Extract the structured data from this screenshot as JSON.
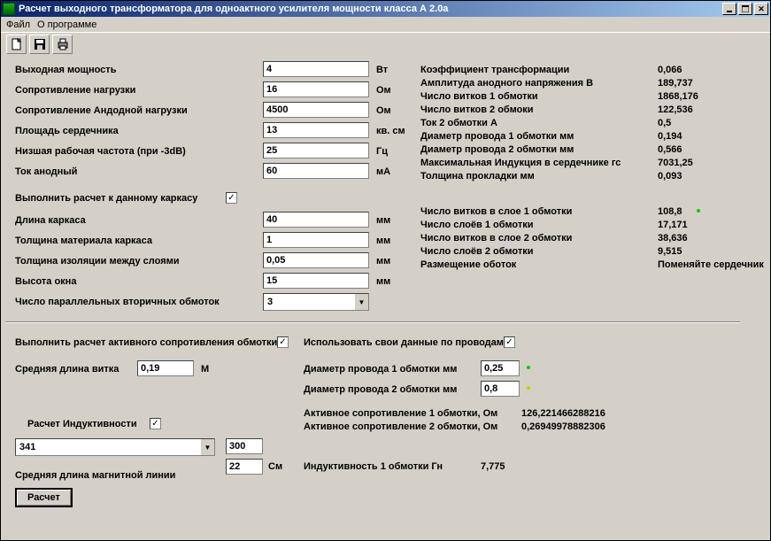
{
  "window": {
    "title": "Расчет выходного трансформатора для одноактного  усилителя мощности класса А  2.0a"
  },
  "menu": {
    "file": "Файл",
    "about": "О программе"
  },
  "colors": {
    "titlebar_start": "#0a246a",
    "titlebar_end": "#a6caf0",
    "bg": "#d4d0c8"
  },
  "inputs_left": {
    "out_power": {
      "label": "Выходная мощность",
      "value": "4",
      "unit": "Вт"
    },
    "load_res": {
      "label": "Сопротивление нагрузки",
      "value": "16",
      "unit": "Ом"
    },
    "anode_load_res": {
      "label": "Сопротивление Андодной нагрузки",
      "value": "4500",
      "unit": "Ом"
    },
    "core_area": {
      "label": "Площадь сердечника",
      "value": "13",
      "unit": "кв. см"
    },
    "low_freq": {
      "label": "Низшая рабочая частота (при -3dB)",
      "value": "25",
      "unit": "Гц"
    },
    "anode_current": {
      "label": "Ток анодный",
      "value": "60",
      "unit": "мА"
    },
    "calc_to_frame": {
      "label": "Выполнить расчет к данному каркасу",
      "checked": true
    },
    "frame_len": {
      "label": "Длина каркаса",
      "value": "40",
      "unit": "мм"
    },
    "frame_thickness": {
      "label": "Толщина материала каркаса",
      "value": "1",
      "unit": "мм"
    },
    "insul_thickness": {
      "label": "Толщина изоляции между слоями",
      "value": "0,05",
      "unit": "мм"
    },
    "window_height": {
      "label": "Высота окна",
      "value": "15",
      "unit": "мм"
    },
    "parallel_secondary": {
      "label": "Число параллельных вторичных обмоток",
      "value": "3"
    }
  },
  "results_right": {
    "trans_coef": {
      "label": "Коэффициент трансформации",
      "value": "0,066"
    },
    "anode_voltage": {
      "label": "Амплитуда анодного напряжения В",
      "value": "189,737"
    },
    "turns1": {
      "label": "Число витков 1 обмотки",
      "value": "1868,176"
    },
    "turns2": {
      "label": "Число витков 2 обмоки",
      "value": "122,536"
    },
    "current2": {
      "label": "Ток 2 обмотки А",
      "value": "0,5"
    },
    "wire1_dia": {
      "label": "Диаметр провода 1 обмотки мм",
      "value": "0,194"
    },
    "wire2_dia": {
      "label": "Диаметр провода 2 обмотки мм",
      "value": "0,566"
    },
    "max_induction": {
      "label": "Максимальная Индукция в сердечнике гс",
      "value": "7031,25"
    },
    "gasket_thickness": {
      "label": "Толщина прокладки мм",
      "value": "0,093"
    },
    "turns_layer1": {
      "label": "Число витков в слое 1 обмотки",
      "value": "108,8"
    },
    "layers1": {
      "label": "Число слоёв 1 обмотки",
      "value": "17,171"
    },
    "turns_layer2": {
      "label": "Число витков в слое 2 обмотки",
      "value": "38,636"
    },
    "layers2": {
      "label": "Число слоёв 2 обмотки",
      "value": "9,515"
    },
    "coil_placement": {
      "label": "Размещение оботок",
      "value": "Поменяйте сердечник"
    }
  },
  "section_active": {
    "calc_active": {
      "label": "Выполнить расчет активного сопротивления обмотки",
      "checked": true
    },
    "use_own_wire": {
      "label": "Использовать свои данные по проводам",
      "checked": true
    },
    "avg_turn_len": {
      "label": "Средняя длина витка",
      "value": "0,19",
      "unit": "М"
    },
    "wire1_d": {
      "label": "Диаметр провода 1 обмотки мм",
      "value": "0,25"
    },
    "wire2_d": {
      "label": "Диаметр провода 2 обмотки мм",
      "value": "0,8"
    },
    "active_res1": {
      "label": "Активное сопротивление 1 обмотки, Ом",
      "value": "126,221466288216"
    },
    "active_res2": {
      "label": "Активное сопротивление 2 обмотки, Ом",
      "value": "0,26949978882306"
    }
  },
  "section_induct": {
    "calc_induct": {
      "label": "Расчет Индуктивности",
      "checked": true
    },
    "dropdown_value": "341",
    "num1": {
      "value": "300"
    },
    "num2": {
      "value": "22",
      "unit": "См"
    },
    "avg_mag_line": "Средняя длина магнитной линии",
    "inductance": {
      "label": "Индуктивность 1 обмотки Гн",
      "value": "7,775"
    }
  },
  "button_calc": "Расчет"
}
